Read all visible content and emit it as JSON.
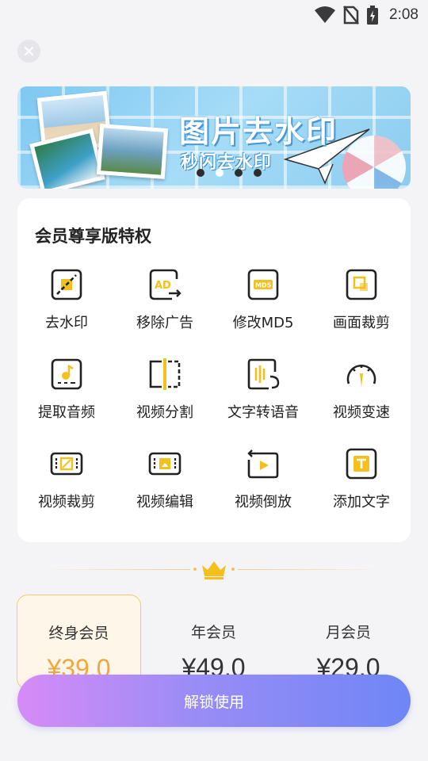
{
  "status_bar": {
    "time": "2:08",
    "icons": [
      "wifi-icon",
      "no-sim-icon",
      "battery-charging-icon"
    ]
  },
  "banner": {
    "title": "图片去水印",
    "subtitle": "秒闪去水印",
    "page_count": 4,
    "active_index": 1
  },
  "privileges": {
    "title": "会员尊享版特权",
    "items": [
      {
        "label": "去水印",
        "icon": "watermark-remove-icon"
      },
      {
        "label": "移除广告",
        "icon": "ad-remove-icon"
      },
      {
        "label": "修改MD5",
        "icon": "md5-icon"
      },
      {
        "label": "画面裁剪",
        "icon": "frame-crop-icon"
      },
      {
        "label": "提取音频",
        "icon": "audio-extract-icon"
      },
      {
        "label": "视频分割",
        "icon": "video-split-icon"
      },
      {
        "label": "文字转语音",
        "icon": "text-to-speech-icon"
      },
      {
        "label": "视频变速",
        "icon": "speedometer-icon"
      },
      {
        "label": "视频裁剪",
        "icon": "video-crop-icon"
      },
      {
        "label": "视频编辑",
        "icon": "video-edit-icon"
      },
      {
        "label": "视频倒放",
        "icon": "video-reverse-icon"
      },
      {
        "label": "添加文字",
        "icon": "add-text-icon"
      }
    ]
  },
  "plans": [
    {
      "name": "终身会员",
      "price": "¥39.0",
      "selected": true
    },
    {
      "name": "年会员",
      "price": "¥49.0",
      "selected": false
    },
    {
      "name": "月会员",
      "price": "¥29.0",
      "selected": false
    }
  ],
  "unlock_button": {
    "label": "解锁使用"
  },
  "colors": {
    "accent_yellow": "#f3c01e",
    "selected_price": "#f0a83a",
    "button_start": "#d68bf7",
    "button_end": "#6f86f6"
  }
}
